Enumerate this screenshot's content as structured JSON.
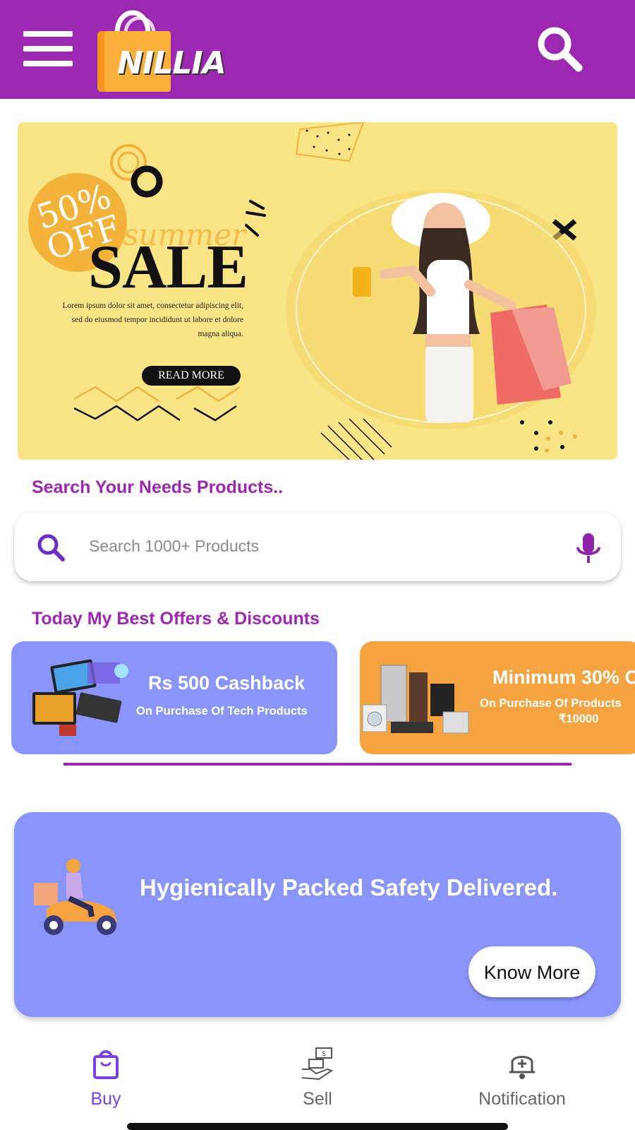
{
  "header": {
    "logo_text": "NILLIA",
    "icons": [
      "menu-icon",
      "logo-bag-icon",
      "search-icon"
    ],
    "background_color": "#9c27b0"
  },
  "banner": {
    "badge": "50% OFF",
    "script_text": "summer",
    "headline": "SALE",
    "body": "Lorem ipsum dolor sit amet, consectetur adipiscing elit, sed do eiusmod tempor incididunt ut labore et dolore magna aliqua.",
    "button_label": "READ MORE",
    "background_color": "#f9e486"
  },
  "search": {
    "section_title": "Search Your Needs Products..",
    "placeholder": "Search 1000+ Products",
    "icons": [
      "search-icon",
      "microphone-icon"
    ]
  },
  "offers": {
    "section_title": "Today My Best Offers & Discounts",
    "items": [
      {
        "title": "Rs 500 Cashback",
        "subtitle": "On Purchase Of Tech Products",
        "color": "#8995fb"
      },
      {
        "title": "Minimum 30% O",
        "subtitle": "On Purchase Of Products",
        "subtitle2": "₹10000",
        "color": "#f5a341"
      }
    ]
  },
  "delivery": {
    "text": "Hygienically Packed Safety Delivered.",
    "button_label": "Know More",
    "color": "#8995fb"
  },
  "bottom_nav": {
    "items": [
      {
        "label": "Buy",
        "icon": "shopping-bag-icon",
        "active": true
      },
      {
        "label": "Sell",
        "icon": "sell-hand-icon",
        "active": false
      },
      {
        "label": "Notification",
        "icon": "bell-plus-icon",
        "active": false
      }
    ],
    "active_color": "#7b3fe4",
    "inactive_color": "#666666"
  }
}
